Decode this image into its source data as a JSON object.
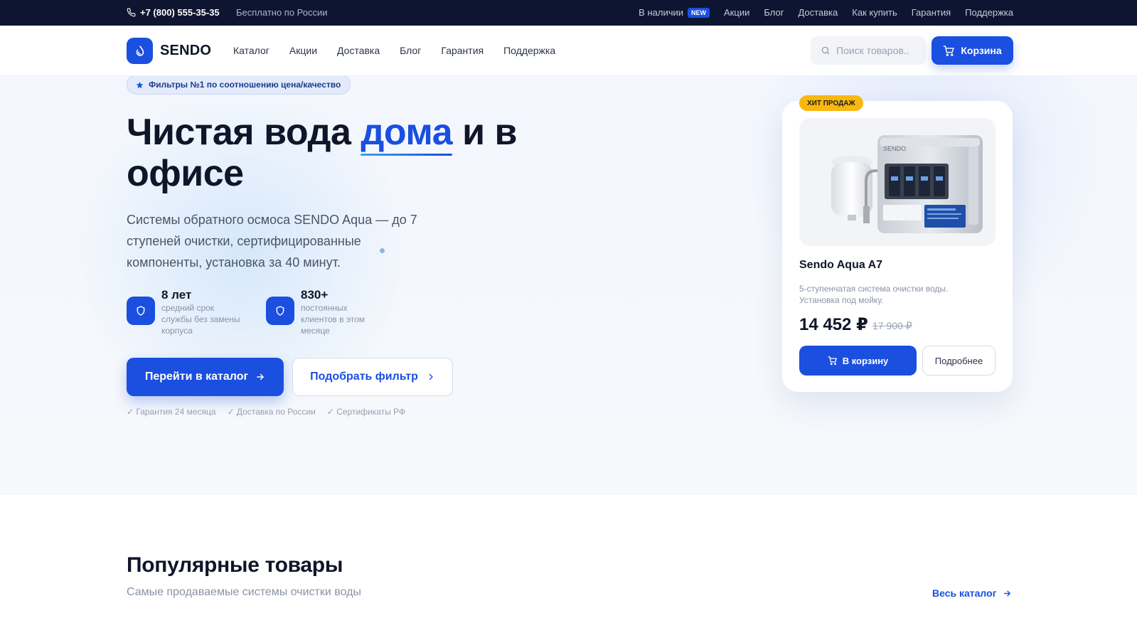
{
  "topbar": {
    "phone": "+7 (800) 555-35-35",
    "free_note": "Бесплатно по России",
    "links": [
      "В наличии",
      "Акции",
      "Блог",
      "Доставка",
      "Как купить",
      "Гарантия",
      "Поддержка"
    ],
    "new_badge": "NEW"
  },
  "header": {
    "logo": "SENDO",
    "nav": [
      "Каталог",
      "Акции",
      "Доставка",
      "Блог",
      "Гарантия",
      "Поддержка"
    ],
    "search_placeholder": "Поиск товаров..",
    "cart_label": "Корзина"
  },
  "hero": {
    "pill": "Фильтры №1 по соотношению цена/качество",
    "title_part1": "Чистая вода ",
    "title_accent": "дома",
    "title_part2": " и в офисе",
    "subtitle": "Системы обратного осмоса SENDO Aqua — до 7 ступеней очистки, сертифицированные компоненты, установка за 40 минут.",
    "stats": [
      {
        "value": "8 лет",
        "label": "средний срок службы без замены корпуса"
      },
      {
        "value": "830+",
        "label": "постоянных клиентов в этом месяце"
      }
    ],
    "primary_button": "Перейти в каталог",
    "secondary_button": "Подобрать фильтр",
    "checks": [
      "✓ Гарантия 24 месяца",
      "✓ Доставка по России",
      "✓ Сертификаты РФ"
    ]
  },
  "product_card": {
    "badge": "ХИТ ПРОДАЖ",
    "device_brand": "SENDO",
    "name": "Sendo Aqua A7",
    "description": "5-ступенчатая система очистки воды. Установка под мойку.",
    "price": "14 452 ₽",
    "old_price": "17 900 ₽",
    "cart_button": "В корзину",
    "details_button": "Подробнее"
  },
  "popular": {
    "title": "Популярные товары",
    "subtitle": "Самые продаваемые системы очистки воды",
    "all_link": "Весь каталог"
  },
  "colors": {
    "accent": "#1a4fe0",
    "topbar_bg": "#0d1530",
    "badge_yellow": "#f9b80f"
  },
  "icons": [
    "phone-icon",
    "droplet-logo-icon",
    "search-icon",
    "cart-icon",
    "star-icon",
    "shield-icon",
    "arrow-right-icon",
    "chevron-right-icon"
  ]
}
